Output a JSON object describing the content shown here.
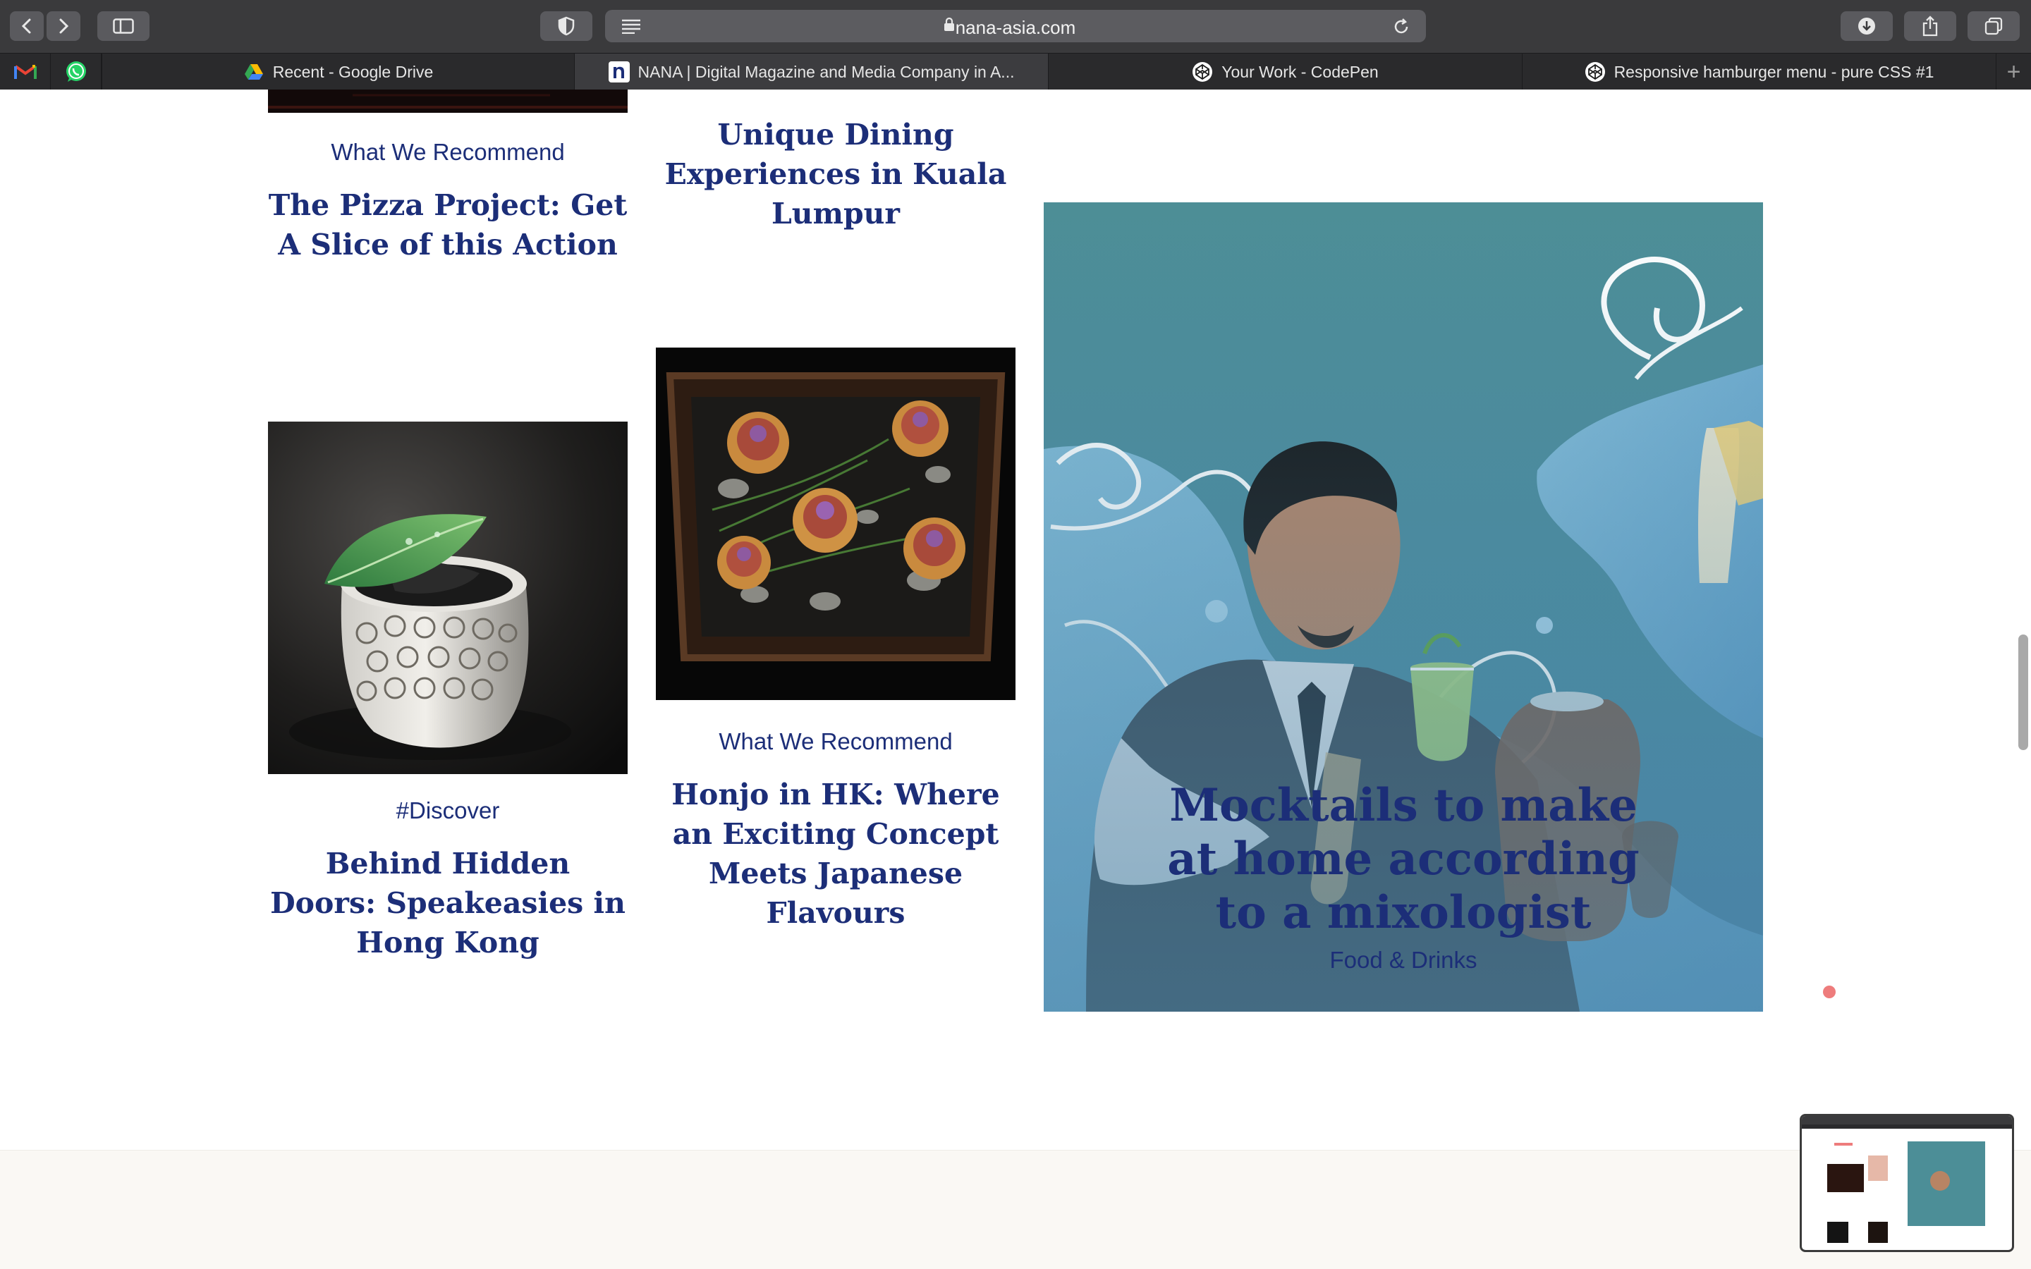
{
  "browser": {
    "url": "nana-asia.com",
    "tabs": [
      {
        "label": "Recent - Google Drive",
        "icon": "google-drive-icon"
      },
      {
        "label": "NANA | Digital Magazine and Media Company in A...",
        "icon": "nana-logo-icon",
        "active": true
      },
      {
        "label": "Your Work - CodePen",
        "icon": "codepen-icon"
      },
      {
        "label": "Responsive hamburger menu - pure CSS #1",
        "icon": "codepen-icon"
      }
    ],
    "pinned": [
      "gmail-icon",
      "whatsapp-icon"
    ],
    "new_tab": "+"
  },
  "articles": {
    "pizza": {
      "category": "What We Recommend",
      "title": "The Pizza Project: Get A Slice of this Action"
    },
    "dining": {
      "title": "Unique Dining Experiences in Kuala Lumpur"
    },
    "hidden": {
      "category": "#Discover",
      "title": "Behind Hidden Doors: Speakeasies in Hong Kong"
    },
    "honjo": {
      "category": "What We Recommend",
      "title": "Honjo in HK: Where an Exciting Concept Meets Japanese Flavours"
    },
    "feature": {
      "title": "Mocktails to make at home according to a mixologist",
      "category": "Food & Drinks"
    }
  },
  "colors": {
    "brand_navy": "#1c2e78",
    "feature_teal": "#4c8e97",
    "chrome_dark": "#3a3a3c",
    "accent_dot": "#ee7c7c"
  }
}
